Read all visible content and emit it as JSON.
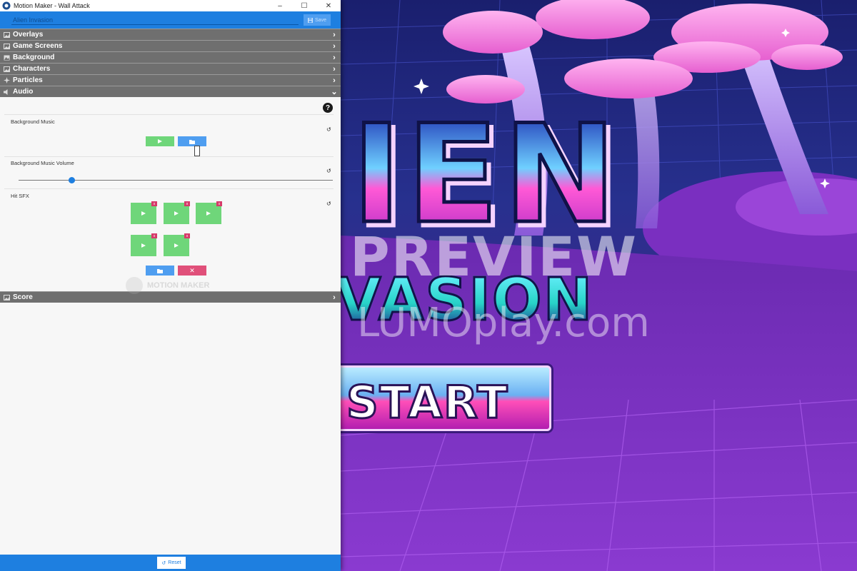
{
  "window": {
    "title": "Motion Maker - Wall Attack",
    "minimize": "–",
    "maximize": "☐",
    "close": "✕"
  },
  "toolbar": {
    "name_value": "Alien Invasion",
    "save_label": "Save"
  },
  "sections": [
    {
      "label": "Overlays",
      "icon": "image-icon",
      "expanded": false
    },
    {
      "label": "Game Screens",
      "icon": "image-icon",
      "expanded": false
    },
    {
      "label": "Background",
      "icon": "landscape-icon",
      "expanded": false
    },
    {
      "label": "Characters",
      "icon": "image-icon",
      "expanded": false
    },
    {
      "label": "Particles",
      "icon": "sparkle-icon",
      "expanded": false
    },
    {
      "label": "Audio",
      "icon": "speaker-icon",
      "expanded": true
    },
    {
      "label": "Score",
      "icon": "image-icon",
      "expanded": false
    }
  ],
  "audio": {
    "help": "?",
    "background_music_label": "Background Music",
    "background_music_volume_label": "Background Music Volume",
    "volume_value": 0.17,
    "hit_sfx_label": "Hit SFX",
    "hit_sfx_count": 5,
    "sfx_remove_mark": "x",
    "delete_mark": "✕"
  },
  "watermark": {
    "motion_maker": "MOTION MAKER"
  },
  "footer": {
    "reset_label": "Reset"
  },
  "game": {
    "title_top": "IEN",
    "title_bottom": "VASION",
    "watermark_preview": "PREVIEW",
    "watermark_site": "LUMOplay.com",
    "start_label": "START"
  },
  "colors": {
    "accent": "#1e7fe0",
    "section_header": "#6f6f6f",
    "play_green": "#6fd67a",
    "folder_blue": "#4f9ef0",
    "delete_pink": "#e0507a"
  }
}
